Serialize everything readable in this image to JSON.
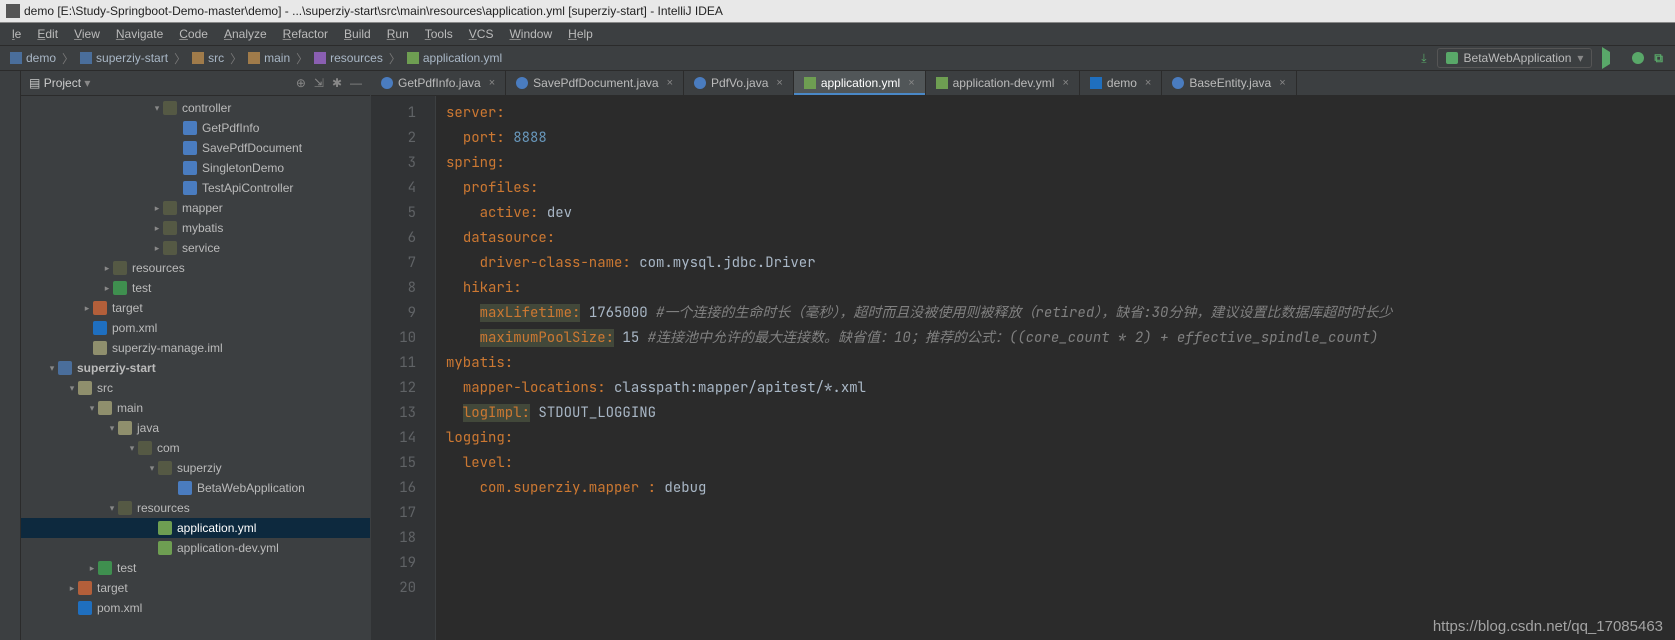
{
  "window": {
    "title": "demo [E:\\Study-Springboot-Demo-master\\demo] - ...\\superziy-start\\src\\main\\resources\\application.yml [superziy-start] - IntelliJ IDEA"
  },
  "menu": [
    "le",
    "Edit",
    "View",
    "Navigate",
    "Code",
    "Analyze",
    "Refactor",
    "Build",
    "Run",
    "Tools",
    "VCS",
    "Window",
    "Help"
  ],
  "breadcrumb": [
    "demo",
    "superziy-start",
    "src",
    "main",
    "resources",
    "application.yml"
  ],
  "runconfig": "BetaWebApplication",
  "project_header": "Project",
  "tree": [
    {
      "indent": 110,
      "arrow": "▾",
      "icon": "ico-dir-dark",
      "label": "controller"
    },
    {
      "indent": 130,
      "arrow": "",
      "icon": "ico-java",
      "label": "GetPdfInfo"
    },
    {
      "indent": 130,
      "arrow": "",
      "icon": "ico-java",
      "label": "SavePdfDocument"
    },
    {
      "indent": 130,
      "arrow": "",
      "icon": "ico-java",
      "label": "SingletonDemo"
    },
    {
      "indent": 130,
      "arrow": "",
      "icon": "ico-java",
      "label": "TestApiController"
    },
    {
      "indent": 110,
      "arrow": "▸",
      "icon": "ico-dir-dark",
      "label": "mapper"
    },
    {
      "indent": 110,
      "arrow": "▸",
      "icon": "ico-dir-dark",
      "label": "mybatis"
    },
    {
      "indent": 110,
      "arrow": "▸",
      "icon": "ico-dir-dark",
      "label": "service"
    },
    {
      "indent": 60,
      "arrow": "▸",
      "icon": "ico-dir-dark",
      "label": "resources"
    },
    {
      "indent": 60,
      "arrow": "▸",
      "icon": "ico-test",
      "label": "test"
    },
    {
      "indent": 40,
      "arrow": "▸",
      "icon": "ico-target",
      "label": "target"
    },
    {
      "indent": 40,
      "arrow": "",
      "icon": "ico-mvn",
      "label": "pom.xml"
    },
    {
      "indent": 40,
      "arrow": "",
      "icon": "ico-iml",
      "label": "superziy-manage.iml"
    },
    {
      "indent": 5,
      "arrow": "▾",
      "icon": "ico-modf",
      "label": "superziy-start",
      "bold": true
    },
    {
      "indent": 25,
      "arrow": "▾",
      "icon": "ico-dir",
      "label": "src"
    },
    {
      "indent": 45,
      "arrow": "▾",
      "icon": "ico-dir",
      "label": "main"
    },
    {
      "indent": 65,
      "arrow": "▾",
      "icon": "ico-dir",
      "label": "java"
    },
    {
      "indent": 85,
      "arrow": "▾",
      "icon": "ico-dir-dark",
      "label": "com"
    },
    {
      "indent": 105,
      "arrow": "▾",
      "icon": "ico-dir-dark",
      "label": "superziy"
    },
    {
      "indent": 125,
      "arrow": "",
      "icon": "ico-java",
      "label": "BetaWebApplication"
    },
    {
      "indent": 65,
      "arrow": "▾",
      "icon": "ico-dir-dark",
      "label": "resources"
    },
    {
      "indent": 105,
      "arrow": "",
      "icon": "ico-yml",
      "label": "application.yml",
      "sel": true
    },
    {
      "indent": 105,
      "arrow": "",
      "icon": "ico-yml",
      "label": "application-dev.yml"
    },
    {
      "indent": 45,
      "arrow": "▸",
      "icon": "ico-test",
      "label": "test"
    },
    {
      "indent": 25,
      "arrow": "▸",
      "icon": "ico-target",
      "label": "target"
    },
    {
      "indent": 25,
      "arrow": "",
      "icon": "ico-mvn",
      "label": "pom.xml"
    }
  ],
  "tabs": [
    {
      "icon": "ico-jk",
      "label": "GetPdfInfo.java"
    },
    {
      "icon": "ico-jk",
      "label": "SavePdfDocument.java"
    },
    {
      "icon": "ico-jk",
      "label": "PdfVo.java"
    },
    {
      "icon": "ico-yk",
      "label": "application.yml",
      "active": true
    },
    {
      "icon": "ico-yk",
      "label": "application-dev.yml"
    },
    {
      "icon": "ico-maven",
      "label": "demo"
    },
    {
      "icon": "ico-jclass",
      "label": "BaseEntity.java"
    }
  ],
  "code": {
    "lines": [
      {
        "n": 1,
        "segs": [
          {
            "t": "server:",
            "c": "k"
          }
        ]
      },
      {
        "n": 2,
        "segs": [
          {
            "t": "  ",
            "c": "s"
          },
          {
            "t": "port:",
            "c": "k"
          },
          {
            "t": " ",
            "c": "s"
          },
          {
            "t": "8888",
            "c": "n"
          }
        ]
      },
      {
        "n": 3,
        "segs": [
          {
            "t": "spring:",
            "c": "k"
          }
        ]
      },
      {
        "n": 4,
        "segs": [
          {
            "t": "  ",
            "c": "s"
          },
          {
            "t": "profiles:",
            "c": "k"
          }
        ]
      },
      {
        "n": 5,
        "segs": [
          {
            "t": "    ",
            "c": "s"
          },
          {
            "t": "active:",
            "c": "k"
          },
          {
            "t": " dev",
            "c": "s"
          }
        ]
      },
      {
        "n": 6,
        "segs": [
          {
            "t": "  ",
            "c": "s"
          },
          {
            "t": "datasource:",
            "c": "k"
          }
        ]
      },
      {
        "n": 7,
        "segs": [
          {
            "t": "    ",
            "c": "s"
          },
          {
            "t": "driver-class-name:",
            "c": "k"
          },
          {
            "t": " com.mysql.jdbc.Driver",
            "c": "s"
          }
        ]
      },
      {
        "n": 8,
        "segs": [
          {
            "t": "  ",
            "c": "s"
          },
          {
            "t": "hikari:",
            "c": "k"
          }
        ]
      },
      {
        "n": 9,
        "segs": [
          {
            "t": "    ",
            "c": "s"
          },
          {
            "t": "maxLifetime:",
            "c": "khl"
          },
          {
            "t": " 1765000 ",
            "c": "s"
          },
          {
            "t": "#一个连接的生命时长（毫秒），超时而且没被使用则被释放（retired），缺省:30分钟，建议设置比数据库超时时长少",
            "c": "c"
          }
        ]
      },
      {
        "n": 10,
        "segs": [
          {
            "t": "    ",
            "c": "s"
          },
          {
            "t": "maximumPoolSize:",
            "c": "khl"
          },
          {
            "t": " 15 ",
            "c": "s"
          },
          {
            "t": "#连接池中允许的最大连接数。缺省值：10；推荐的公式：((core_count * 2) + effective_spindle_count)",
            "c": "c"
          }
        ]
      },
      {
        "n": 11,
        "segs": [
          {
            "t": "",
            "c": "s"
          }
        ]
      },
      {
        "n": 12,
        "segs": [
          {
            "t": "",
            "c": "s"
          }
        ]
      },
      {
        "n": 13,
        "segs": [
          {
            "t": "",
            "c": "s"
          }
        ]
      },
      {
        "n": 14,
        "segs": [
          {
            "t": "mybatis:",
            "c": "k"
          }
        ]
      },
      {
        "n": 15,
        "segs": [
          {
            "t": "  ",
            "c": "s"
          },
          {
            "t": "mapper-locations:",
            "c": "k"
          },
          {
            "t": " classpath:mapper/apitest/*.xml",
            "c": "s"
          }
        ]
      },
      {
        "n": 16,
        "segs": [
          {
            "t": "  ",
            "c": "s"
          },
          {
            "t": "logImpl:",
            "c": "khl"
          },
          {
            "t": " STDOUT_LOGGING",
            "c": "s"
          }
        ]
      },
      {
        "n": 17,
        "segs": [
          {
            "t": "logging:",
            "c": "k"
          }
        ]
      },
      {
        "n": 18,
        "segs": [
          {
            "t": "  ",
            "c": "s"
          },
          {
            "t": "level:",
            "c": "k"
          }
        ]
      },
      {
        "n": 19,
        "segs": [
          {
            "t": "    ",
            "c": "s"
          },
          {
            "t": "com.superziy.mapper :",
            "c": "k"
          },
          {
            "t": " debug",
            "c": "s"
          }
        ]
      },
      {
        "n": 20,
        "segs": [
          {
            "t": "",
            "c": "s"
          }
        ]
      }
    ]
  },
  "watermark": "https://blog.csdn.net/qq_17085463"
}
